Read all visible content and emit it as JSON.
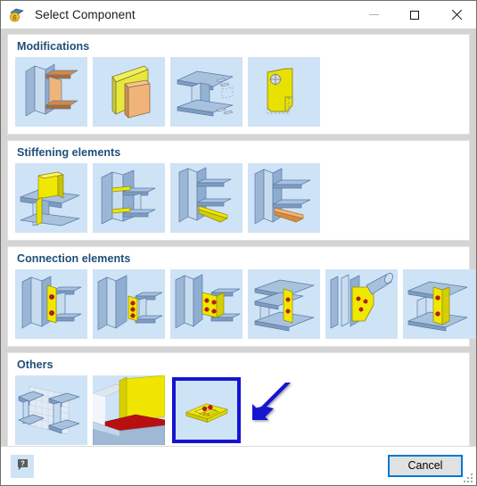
{
  "window": {
    "title": "Select Component",
    "icon": "app-component-icon",
    "controls": {
      "minimize": "—",
      "maximize": "□",
      "close": "✕"
    }
  },
  "groups": [
    {
      "id": "modifications",
      "title": "Modifications",
      "items": [
        {
          "id": "mod-1",
          "art": "beam-plate-web",
          "selected": false
        },
        {
          "id": "mod-2",
          "art": "yellow-angled-plate",
          "selected": false
        },
        {
          "id": "mod-3",
          "art": "beam-cut-notch",
          "selected": false
        },
        {
          "id": "mod-4",
          "art": "yellow-contour-plate",
          "selected": false
        }
      ]
    },
    {
      "id": "stiffening-elements",
      "title": "Stiffening elements",
      "items": [
        {
          "id": "stif-1",
          "art": "beam-vertical-stiffener",
          "selected": false
        },
        {
          "id": "stif-2",
          "art": "column-horizontal-stiffeners",
          "selected": false
        },
        {
          "id": "stif-3",
          "art": "beam-yellow-haunch",
          "selected": false
        },
        {
          "id": "stif-4",
          "art": "beam-orange-gusset",
          "selected": false
        }
      ]
    },
    {
      "id": "connection-elements",
      "title": "Connection elements",
      "items": [
        {
          "id": "conn-1",
          "art": "end-plate-2-bolts",
          "selected": false
        },
        {
          "id": "conn-2",
          "art": "fin-plate-3-bolts",
          "selected": false
        },
        {
          "id": "conn-3",
          "art": "double-angle-4-bolts",
          "selected": false
        },
        {
          "id": "conn-4",
          "art": "beam-top-plate-bolts",
          "selected": false
        },
        {
          "id": "conn-5",
          "art": "tube-gusset-plate",
          "selected": false
        },
        {
          "id": "conn-6",
          "art": "web-plate-2-bolts",
          "selected": false
        }
      ]
    },
    {
      "id": "others",
      "title": "Others",
      "items": [
        {
          "id": "oth-1",
          "art": "grid-mesh-beam",
          "selected": false
        },
        {
          "id": "oth-2",
          "art": "yellow-red-closeup",
          "selected": false
        },
        {
          "id": "oth-3",
          "art": "yellow-base-plate-bolts",
          "selected": true
        }
      ]
    }
  ],
  "footer": {
    "help_label": "?",
    "help_name": "help-icon",
    "cancel_label": "Cancel"
  },
  "annotation": {
    "arrow": "blue-arrow-pointing-to-selected-item",
    "color": "#1414d2"
  },
  "colors": {
    "accent": "#0078d7",
    "group_title": "#1f4e79",
    "thumb_bg": "#cfe3f7",
    "selection": "#1414d2",
    "dialog_bg": "#d4d4d4"
  }
}
